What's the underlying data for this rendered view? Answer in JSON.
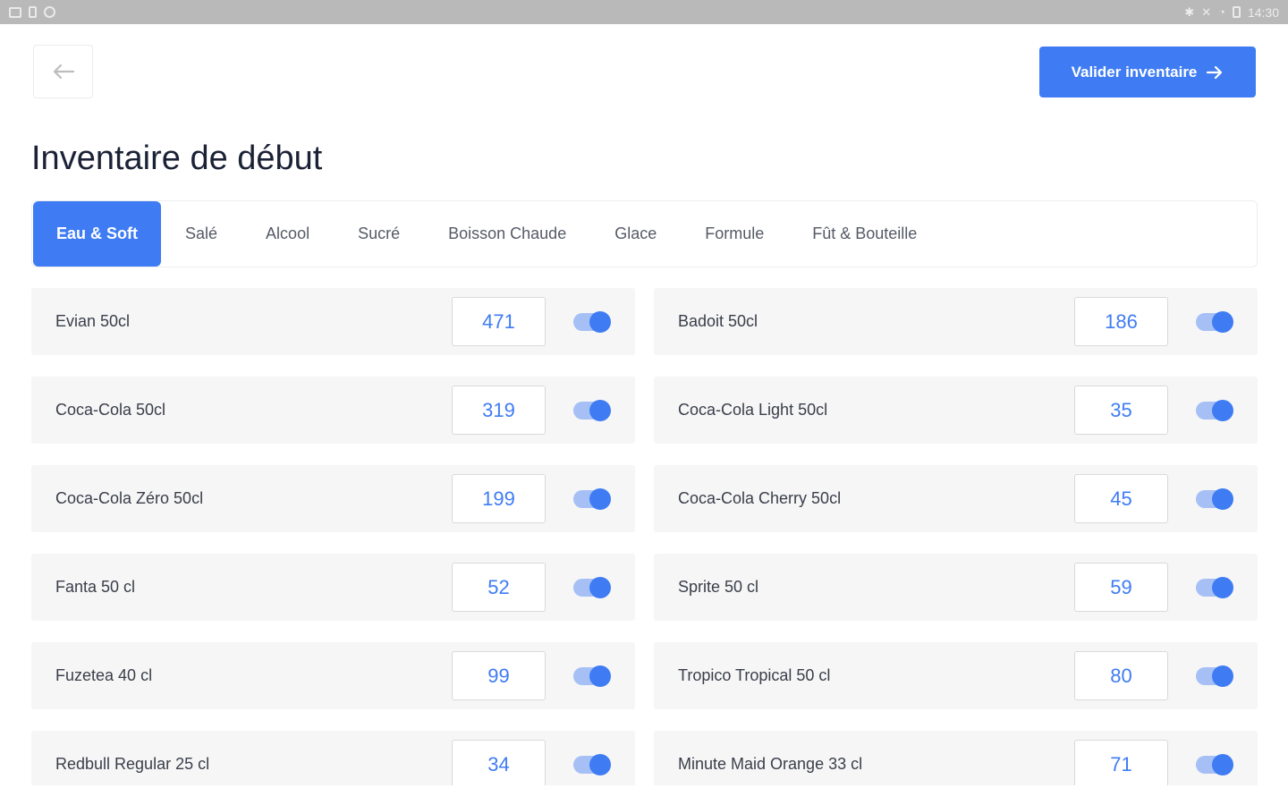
{
  "status_bar": {
    "time": "14:30",
    "left_icons": [
      "gallery-icon",
      "sim-icon",
      "settings-icon"
    ],
    "right_icons": [
      "bluetooth-icon",
      "mute-icon",
      "wifi-icon",
      "battery-icon"
    ]
  },
  "header": {
    "back_icon": "arrow-left-icon",
    "validate_label": "Valider inventaire",
    "validate_icon": "arrow-right-icon"
  },
  "page": {
    "title": "Inventaire de début"
  },
  "tabs": [
    {
      "label": "Eau & Soft",
      "active": true
    },
    {
      "label": "Salé",
      "active": false
    },
    {
      "label": "Alcool",
      "active": false
    },
    {
      "label": "Sucré",
      "active": false
    },
    {
      "label": "Boisson Chaude",
      "active": false
    },
    {
      "label": "Glace",
      "active": false
    },
    {
      "label": "Formule",
      "active": false
    },
    {
      "label": "Fût & Bouteille",
      "active": false
    }
  ],
  "items": [
    {
      "name": "Evian 50cl",
      "qty": "471",
      "enabled": true
    },
    {
      "name": "Badoit 50cl",
      "qty": "186",
      "enabled": true
    },
    {
      "name": "Coca-Cola 50cl",
      "qty": "319",
      "enabled": true
    },
    {
      "name": "Coca-Cola Light 50cl",
      "qty": "35",
      "enabled": true
    },
    {
      "name": "Coca-Cola Zéro 50cl",
      "qty": "199",
      "enabled": true
    },
    {
      "name": "Coca-Cola Cherry 50cl",
      "qty": "45",
      "enabled": true
    },
    {
      "name": "Fanta 50 cl",
      "qty": "52",
      "enabled": true
    },
    {
      "name": "Sprite 50 cl",
      "qty": "59",
      "enabled": true
    },
    {
      "name": "Fuzetea 40 cl",
      "qty": "99",
      "enabled": true
    },
    {
      "name": "Tropico Tropical 50 cl",
      "qty": "80",
      "enabled": true
    },
    {
      "name": "Redbull Regular 25 cl",
      "qty": "34",
      "enabled": true
    },
    {
      "name": "Minute Maid Orange 33 cl",
      "qty": "71",
      "enabled": true
    }
  ],
  "colors": {
    "accent": "#3f7cf3",
    "toggle_track": "#a6c0f6",
    "row_bg": "#f6f6f6",
    "status_bar": "#b9b9b9"
  }
}
